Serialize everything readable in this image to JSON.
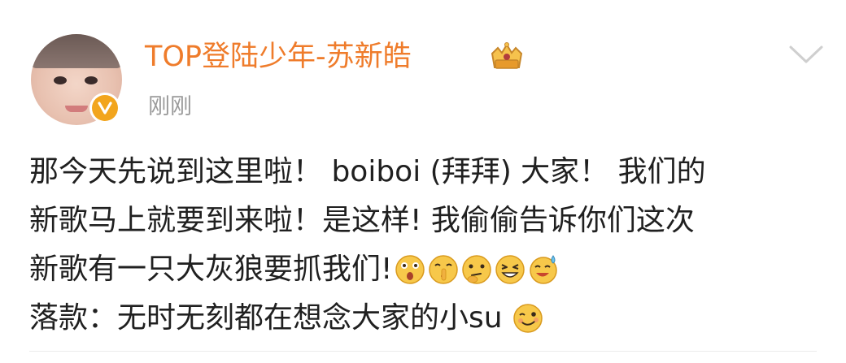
{
  "post": {
    "username": "TOP登陆少年-苏新皓",
    "timestamp": "刚刚",
    "lines": [
      "那今天先说到这里啦！ boiboi (拜拜) 大家！ 我们的",
      "新歌马上就要到来啦！是这样! 我偷偷告诉你们这次",
      "新歌有一只大灰狼要抓我们!",
      "落款：无时无刻都在想念大家的小su"
    ]
  },
  "icons": {
    "avatar": "user-avatar",
    "badge": "verified-badge-icon",
    "crown": "crown-badge-icon",
    "more": "chevron-down-icon",
    "emojis": [
      "shocked-emoji-icon",
      "shush-emoji-icon",
      "thinking-emoji-icon",
      "grin-emoji-icon",
      "sweat-laugh-emoji-icon",
      "wink-emoji-icon"
    ]
  },
  "colors": {
    "username": "#ef7c2b",
    "timestamp": "#9a9a9a",
    "badge": "#f2a51d",
    "text": "#202020"
  }
}
